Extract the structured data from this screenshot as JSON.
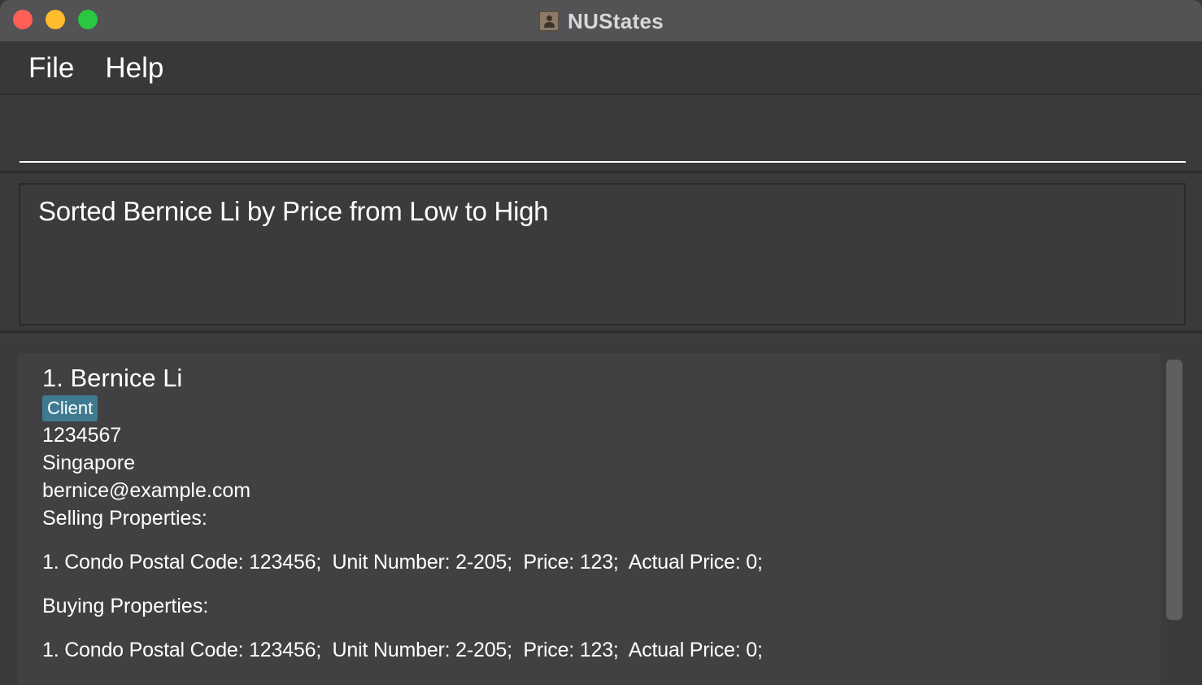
{
  "window": {
    "title": "NUStates"
  },
  "menu": {
    "file": "File",
    "help": "Help"
  },
  "command": {
    "value": ""
  },
  "result": {
    "message": "Sorted Bernice Li by Price from Low to High"
  },
  "persons": [
    {
      "name": "1. Bernice Li",
      "tag": "Client",
      "phone": "1234567",
      "address": "Singapore",
      "email": "bernice@example.com",
      "selling_label": "Selling Properties:",
      "selling": [
        "1. Condo Postal Code: 123456;  Unit Number: 2-205;  Price: 123;  Actual Price: 0;"
      ],
      "buying_label": "Buying Properties:",
      "buying": [
        "1. Condo Postal Code: 123456;  Unit Number: 2-205;  Price: 123;  Actual Price: 0;"
      ]
    }
  ],
  "colors": {
    "close": "#fe5f57",
    "minimize": "#febc2e",
    "zoom": "#28c840",
    "tag": "#3e7b91"
  }
}
